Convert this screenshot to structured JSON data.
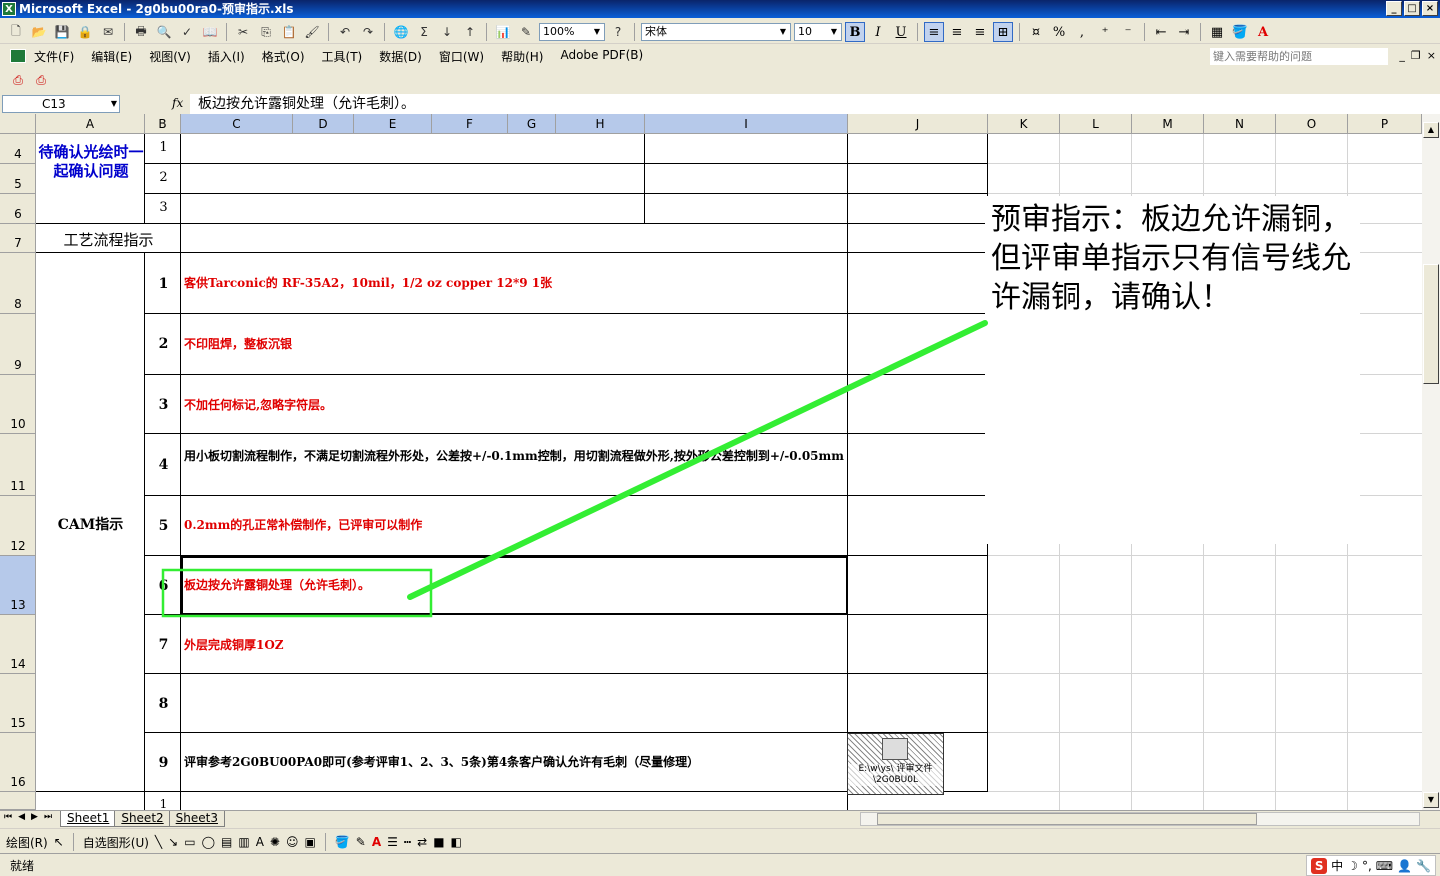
{
  "window": {
    "title": "Microsoft Excel - 2g0bu00ra0-预审指示.xls",
    "min": "_",
    "max": "□",
    "close": "×"
  },
  "toolbar": {
    "zoom": "100%",
    "font": "宋体",
    "size": "10"
  },
  "menu": [
    "文件(F)",
    "编辑(E)",
    "视图(V)",
    "插入(I)",
    "格式(O)",
    "工具(T)",
    "数据(D)",
    "窗口(W)",
    "帮助(H)",
    "Adobe PDF(B)"
  ],
  "help_placeholder": "键入需要帮助的问题",
  "formula": {
    "name_box": "C13",
    "fx": "fx",
    "content": "板边按允许露铜处理（允许毛刺）。"
  },
  "columns": [
    "A",
    "B",
    "C",
    "D",
    "E",
    "F",
    "G",
    "H",
    "I",
    "J",
    "K",
    "L",
    "M",
    "N",
    "O",
    "P"
  ],
  "rows": [
    "4",
    "5",
    "6",
    "7",
    "8",
    "9",
    "10",
    "11",
    "12",
    "13",
    "14",
    "15",
    "16"
  ],
  "cells": {
    "a4": "待确认光绘时一起确认问题",
    "a7": "工艺流程指示",
    "cam": "CAM指示",
    "n4": "1",
    "n5": "2",
    "n6": "3",
    "items": [
      {
        "n": "1",
        "t": "客供Tarconic的 RF-35A2，10mil，1/2 oz copper  12*9 1张"
      },
      {
        "n": "2",
        "t": "不印阻焊，整板沉银"
      },
      {
        "n": "3",
        "t": "不加任何标记,忽略字符层。"
      },
      {
        "n": "4",
        "t": "用小板切割流程制作，不满足切割流程外形处，公差按+/-0.1mm控制，用切割流程做外形,按外形公差控制到+/-0.05mm"
      },
      {
        "n": "5",
        "t": "0.2mm的孔正常补偿制作，已评审可以制作"
      },
      {
        "n": "6",
        "t": "板边按允许露铜处理（允许毛刺）。"
      },
      {
        "n": "7",
        "t": "外层完成铜厚1OZ"
      },
      {
        "n": "8",
        "t": ""
      },
      {
        "n": "9",
        "t": "评审参考2G0BU00PA0即可(参考评审1、2、3、5条)第4条客户确认允许有毛刺（尽量修理）"
      }
    ],
    "n17": "1"
  },
  "comment": "预审指示：板边允许漏铜，但评审单指示只有信号线允许漏铜，请确认！",
  "embedded_object": "E:\\w\\ys\\ 评审文件\\2G0BU0L",
  "sheets": [
    "Sheet1",
    "Sheet2",
    "Sheet3"
  ],
  "drawbar": {
    "draw": "绘图(R)",
    "autoshapes": "自选图形(U)"
  },
  "status": "就绪",
  "ime": "中",
  "colors": {
    "red": "#e00000",
    "blue": "#0000cc",
    "callout_green": "#33ee33"
  }
}
